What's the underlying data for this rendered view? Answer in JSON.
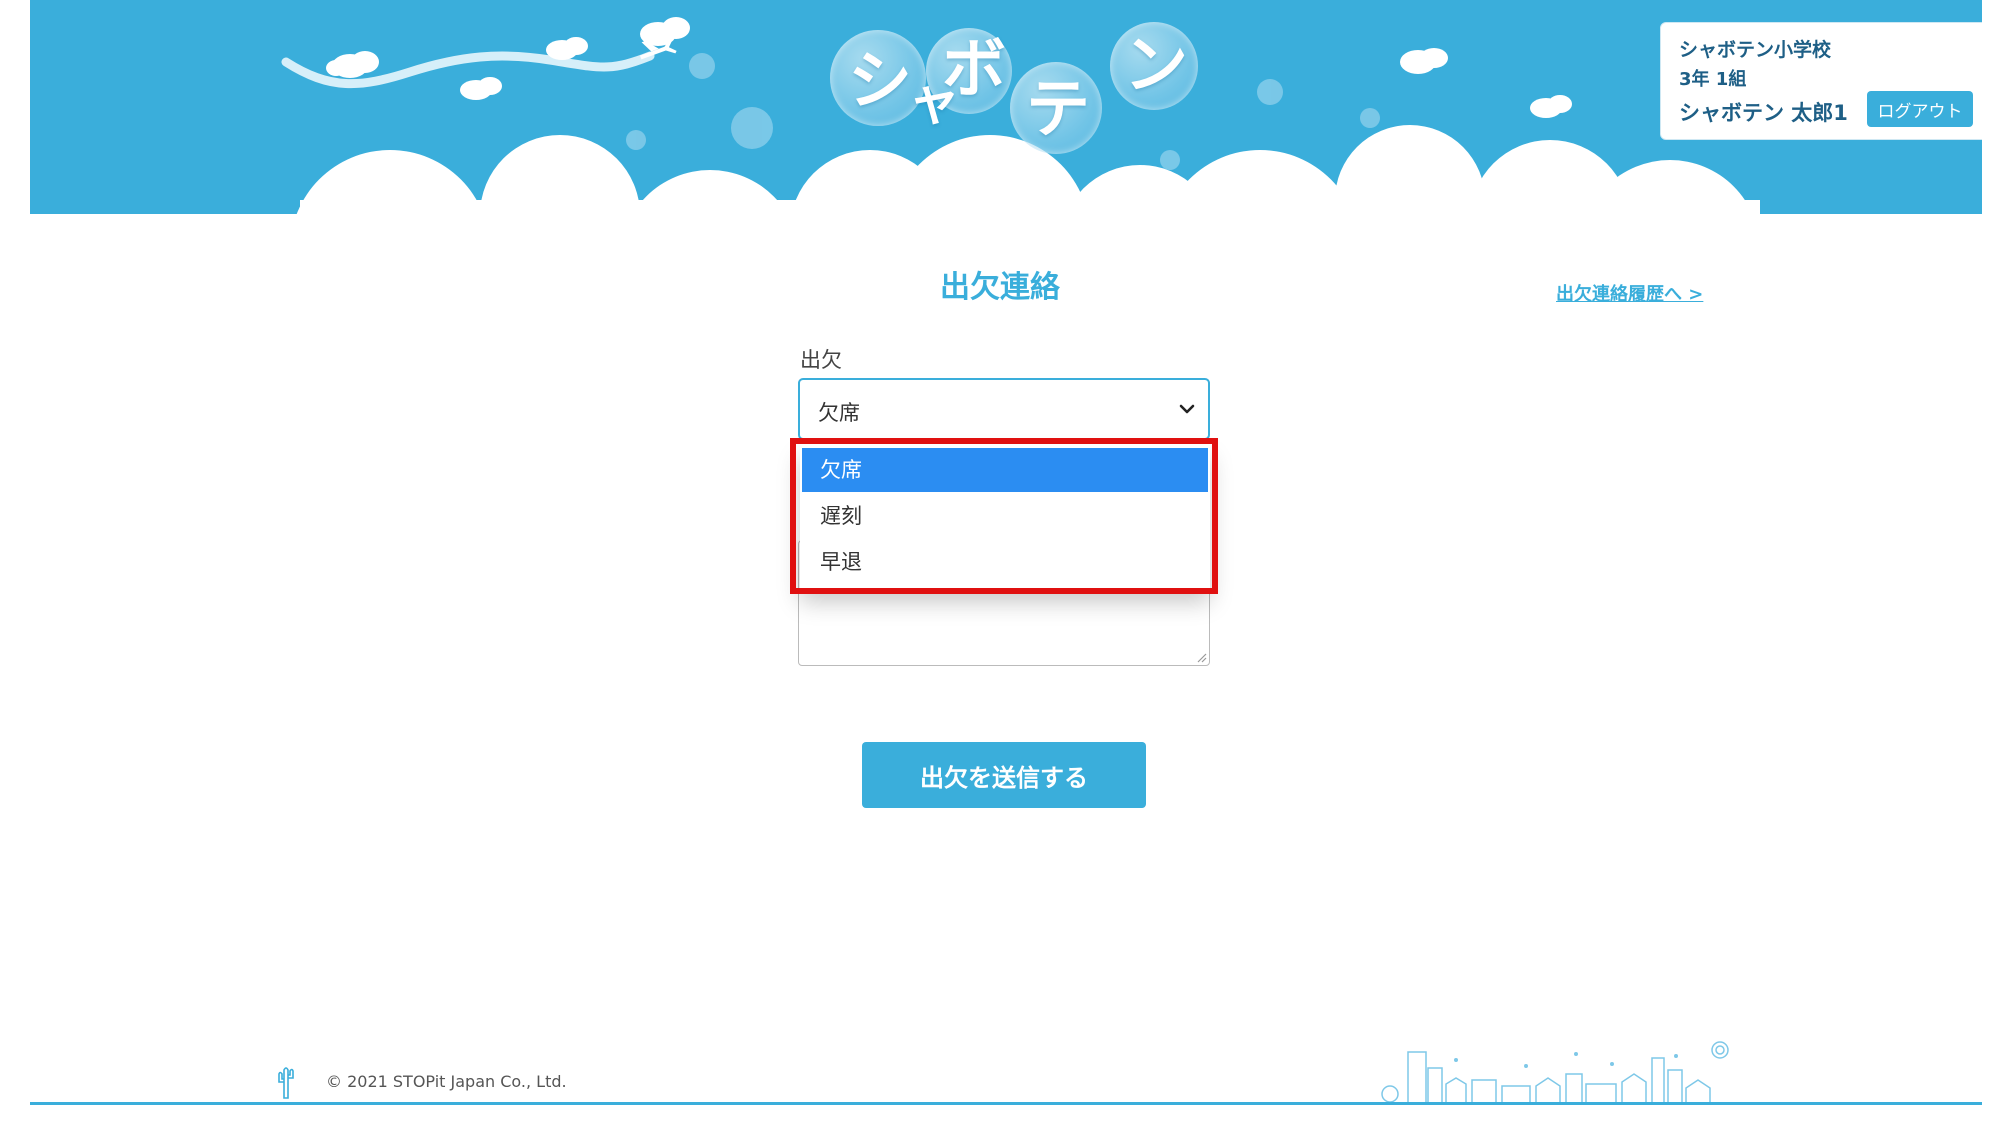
{
  "header": {
    "logo_chars": [
      "シ",
      "ャ",
      "ボ",
      "テ",
      "ン"
    ],
    "logo_alt": "シャボテン"
  },
  "user": {
    "school": "シャボテン小学校",
    "class": "3年 1組",
    "student": "シャボテン 太郎1",
    "logout_label": "ログアウト"
  },
  "main": {
    "title": "出欠連絡",
    "history_link": "出欠連絡履歴へ >",
    "attendance_label": "出欠",
    "attendance_selected": "欠席",
    "attendance_options": [
      {
        "label": "欠席",
        "selected": true
      },
      {
        "label": "遅刻",
        "selected": false
      },
      {
        "label": "早退",
        "selected": false
      }
    ],
    "submit_label": "出欠を送信する"
  },
  "footer": {
    "copyright": "© 2021 STOPit Japan Co., Ltd."
  },
  "colors": {
    "brand": "#3aaedb",
    "selected_option": "#2b8df2",
    "highlight": "#e01010"
  },
  "icons": {
    "select": "chevron-down-icon",
    "footer_left": "cactus-icon",
    "footer_right": "city-illustration",
    "header_plane": "airplane-icon"
  }
}
